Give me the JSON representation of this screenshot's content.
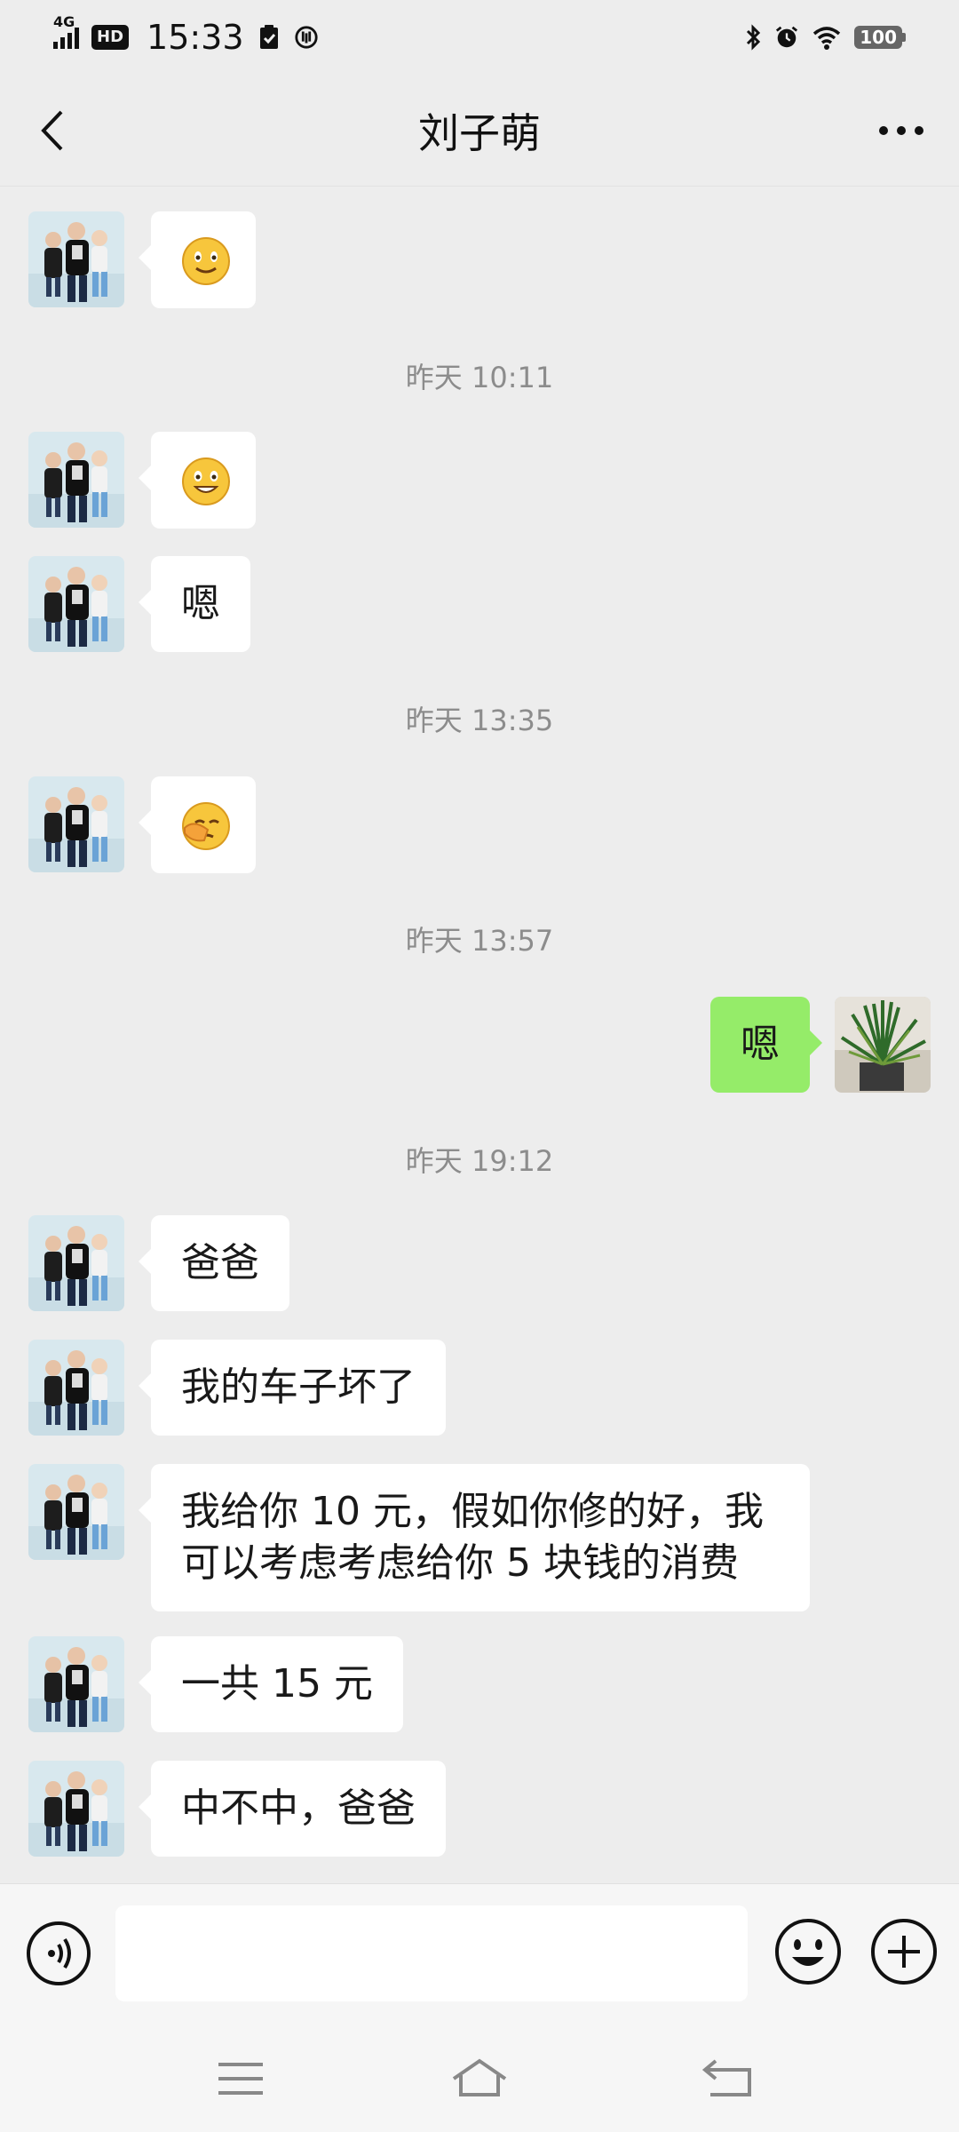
{
  "status_bar": {
    "network": "4G",
    "hd": "HD",
    "time": "15:33",
    "battery": "100"
  },
  "header": {
    "title": "刘子萌"
  },
  "timestamps": [
    "昨天 10:11",
    "昨天 13:35",
    "昨天 13:57",
    "昨天 19:12"
  ],
  "messages": [
    {
      "sender": "刘子萌",
      "type": "emoji",
      "emoji": "smile-emoji"
    },
    {
      "sender": "刘子萌",
      "type": "emoji",
      "emoji": "grin-emoji"
    },
    {
      "sender": "刘子萌",
      "type": "text",
      "text": "嗯"
    },
    {
      "sender": "刘子萌",
      "type": "emoji",
      "emoji": "facepalm-emoji"
    },
    {
      "sender": "me",
      "type": "text",
      "text": "嗯"
    },
    {
      "sender": "刘子萌",
      "type": "text",
      "text": "爸爸"
    },
    {
      "sender": "刘子萌",
      "type": "text",
      "text": "我的车子坏了"
    },
    {
      "sender": "刘子萌",
      "type": "text",
      "text": "我给你 10 元，假如你修的好，我可以考虑考虑给你 5 块钱的消费"
    },
    {
      "sender": "刘子萌",
      "type": "text",
      "text": "一共 15 元"
    },
    {
      "sender": "刘子萌",
      "type": "text",
      "text": "中不中，爸爸"
    }
  ],
  "input": {
    "value": "",
    "placeholder": ""
  },
  "colors": {
    "background": "#ededed",
    "outgoing_bubble": "#95ec69",
    "incoming_bubble": "#ffffff",
    "timestamp": "#8c8c8c"
  }
}
